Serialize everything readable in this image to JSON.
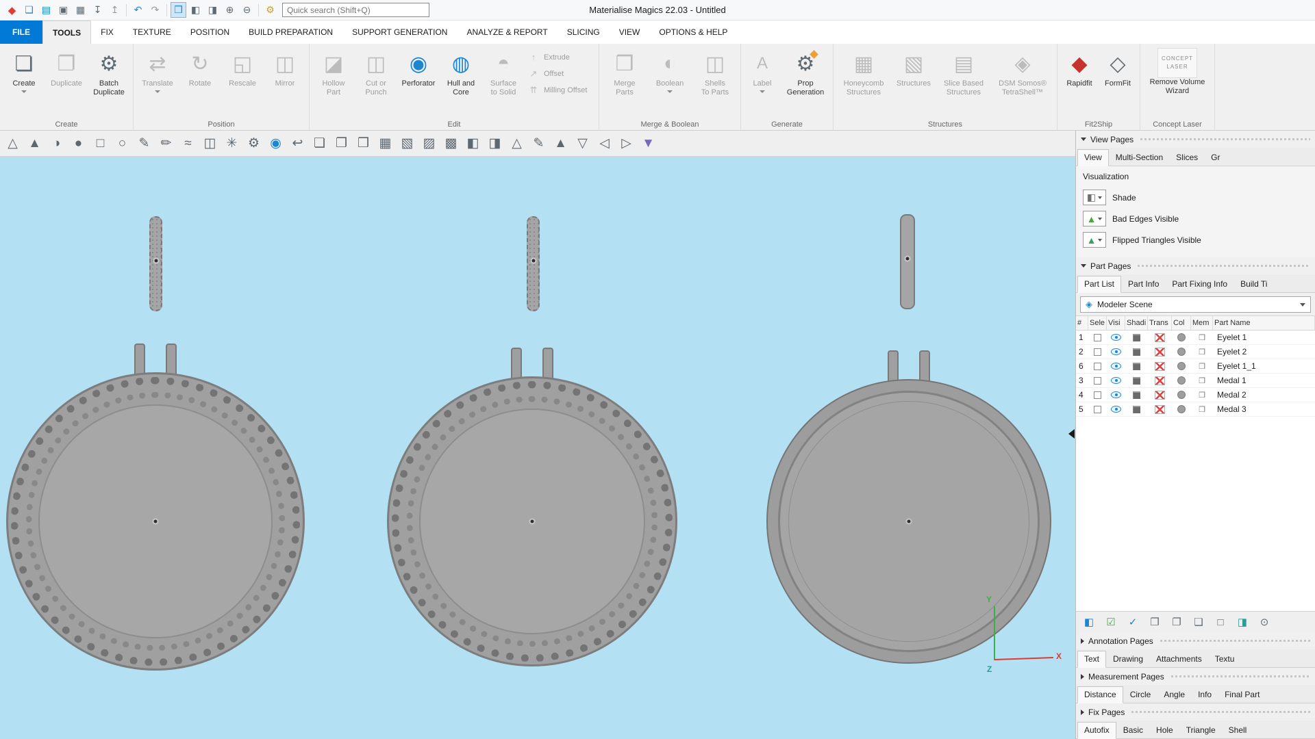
{
  "colors": {
    "accent_blue": "#0079d7",
    "viewport_background": "#b3e0f3",
    "part_gray": "#a0a0a0",
    "eye_blue": "#1c86d1",
    "axis_x_red": "#e0392f",
    "axis_y_green": "#3fae49",
    "axis_z_teal": "#2a9d94",
    "transparency_red": "#e04040"
  },
  "titlebar": {
    "title": "Materialise Magics 22.03 - Untitled",
    "search_placeholder": "Quick search (Shift+Q)",
    "icons": [
      {
        "name": "magics-logo-icon",
        "glyph": "◆"
      },
      {
        "name": "new-document-icon",
        "glyph": "❏"
      },
      {
        "name": "open-file-icon",
        "glyph": "▤"
      },
      {
        "name": "save-icon",
        "glyph": "▣"
      },
      {
        "name": "save-all-icon",
        "glyph": "▦"
      },
      {
        "name": "import-part-icon",
        "glyph": "↧"
      },
      {
        "name": "export-platform-icon",
        "glyph": "↥"
      },
      {
        "name": "undo-icon",
        "glyph": "↶"
      },
      {
        "name": "redo-icon",
        "glyph": "↷"
      },
      {
        "name": "zoom-selection-icon",
        "glyph": "❒"
      },
      {
        "name": "view-rotate-icon",
        "glyph": "◧"
      },
      {
        "name": "view-pan-icon",
        "glyph": "◨"
      },
      {
        "name": "zoom-in-icon",
        "glyph": "⊕"
      },
      {
        "name": "zoom-out-icon",
        "glyph": "⊖"
      },
      {
        "name": "license-key-icon",
        "glyph": "⚙"
      }
    ]
  },
  "menu": {
    "tabs": [
      "FILE",
      "TOOLS",
      "FIX",
      "TEXTURE",
      "POSITION",
      "BUILD PREPARATION",
      "SUPPORT GENERATION",
      "ANALYZE & REPORT",
      "SLICING",
      "VIEW",
      "OPTIONS & HELP"
    ]
  },
  "ribbon": {
    "groups": [
      {
        "name": "Create",
        "buttons": [
          {
            "label": "Create",
            "glyph": "❏"
          },
          {
            "label": "Duplicate",
            "glyph": "❐"
          },
          {
            "label": "Batch\nDuplicate",
            "glyph": "⚙"
          }
        ]
      },
      {
        "name": "Position",
        "buttons": [
          {
            "label": "Translate",
            "glyph": "⇄"
          },
          {
            "label": "Rotate",
            "glyph": "↻"
          },
          {
            "label": "Rescale",
            "glyph": "◱"
          },
          {
            "label": "Mirror",
            "glyph": "◫"
          }
        ]
      },
      {
        "name": "Edit",
        "buttons": [
          {
            "label": "Hollow\nPart",
            "glyph": "◪"
          },
          {
            "label": "Cut or\nPunch",
            "glyph": "◫"
          },
          {
            "label": "Perforator",
            "glyph": "◉"
          },
          {
            "label": "Hull and\nCore",
            "glyph": "◍"
          },
          {
            "label": "Surface\nto Solid",
            "glyph": "◓"
          }
        ],
        "stack": [
          {
            "label": "Extrude",
            "glyph": "↑"
          },
          {
            "label": "Offset",
            "glyph": "↗"
          },
          {
            "label": "Milling Offset",
            "glyph": "⇈"
          }
        ]
      },
      {
        "name": "Merge & Boolean",
        "buttons": [
          {
            "label": "Merge\nParts",
            "glyph": "❒"
          },
          {
            "label": "Boolean",
            "glyph": "◐"
          },
          {
            "label": "Shells\nTo Parts",
            "glyph": "◫"
          }
        ]
      },
      {
        "name": "Generate",
        "buttons": [
          {
            "label": "Label",
            "glyph": "A"
          },
          {
            "label": "Prop\nGeneration",
            "glyph": "⚙"
          }
        ]
      },
      {
        "name": "Structures",
        "buttons": [
          {
            "label": "Honeycomb\nStructures",
            "glyph": "▦"
          },
          {
            "label": "Structures",
            "glyph": "▧"
          },
          {
            "label": "Slice Based\nStructures",
            "glyph": "▤"
          },
          {
            "label": "DSM Somos®\nTetraShell™",
            "glyph": "◈"
          }
        ]
      },
      {
        "name": "Fit2Ship",
        "buttons": [
          {
            "label": "Rapidfit",
            "glyph": "◆"
          },
          {
            "label": "FormFit",
            "glyph": "◇"
          }
        ]
      },
      {
        "name": "Concept Laser",
        "logo": "CONCEPT\nLASER",
        "buttons": [
          {
            "label": "Remove Volume\nWizard"
          }
        ]
      }
    ]
  },
  "toolbar2": {
    "icons": [
      {
        "name": "mark-triangle-icon",
        "glyph": "△"
      },
      {
        "name": "mark-plane-icon",
        "glyph": "▲"
      },
      {
        "name": "mark-surface-icon",
        "glyph": "◑"
      },
      {
        "name": "mark-shell-icon",
        "glyph": "●"
      },
      {
        "name": "rectangle-selection-icon",
        "glyph": "□"
      },
      {
        "name": "ellipse-selection-icon",
        "glyph": "○"
      },
      {
        "name": "freeform-selection-icon",
        "glyph": "✎"
      },
      {
        "name": "brush-selection-icon",
        "glyph": "✏"
      },
      {
        "name": "wave-selection-icon",
        "glyph": "≈"
      },
      {
        "name": "cross-section-icon",
        "glyph": "◫"
      },
      {
        "name": "star-mark-icon",
        "glyph": "✳"
      },
      {
        "name": "gear-mark-icon",
        "glyph": "⚙"
      },
      {
        "name": "ring-mark-icon",
        "glyph": "◉"
      },
      {
        "name": "hook-mark-icon",
        "glyph": "↩"
      },
      {
        "name": "cube-view-top-icon",
        "glyph": "❏"
      },
      {
        "name": "cube-view-front-icon",
        "glyph": "❐"
      },
      {
        "name": "cube-view-side-icon",
        "glyph": "❒"
      },
      {
        "name": "cube-shaded-icon",
        "glyph": "▦"
      },
      {
        "name": "cube-hatched-icon",
        "glyph": "▧"
      },
      {
        "name": "cube-crossed-icon",
        "glyph": "▨"
      },
      {
        "name": "cube-grid-icon",
        "glyph": "▩"
      },
      {
        "name": "cube-half-left-icon",
        "glyph": "◧"
      },
      {
        "name": "cube-half-right-icon",
        "glyph": "◨"
      },
      {
        "name": "triangle-edit-icon",
        "glyph": "△"
      },
      {
        "name": "triangle-pencil-icon",
        "glyph": "✎"
      },
      {
        "name": "triangle-fill-icon",
        "glyph": "▲"
      },
      {
        "name": "triangle-down-icon",
        "glyph": "▽"
      },
      {
        "name": "triangle-left-icon",
        "glyph": "◁"
      },
      {
        "name": "triangle-right-icon",
        "glyph": "▷"
      },
      {
        "name": "triangle-textured-icon",
        "glyph": "▼"
      }
    ]
  },
  "right_panel": {
    "view_pages": {
      "title": "View Pages",
      "tabs": [
        "View",
        "Multi-Section",
        "Slices",
        "Gr"
      ],
      "visualization": {
        "label": "Visualization",
        "rows": [
          {
            "icon": "shade-cube-icon",
            "glyph": "◧",
            "label": "Shade"
          },
          {
            "icon": "bad-edges-icon",
            "glyph": "▲",
            "label": "Bad Edges Visible"
          },
          {
            "icon": "flipped-triangles-icon",
            "glyph": "▲",
            "label": "Flipped Triangles Visible"
          }
        ]
      }
    },
    "part_pages": {
      "title": "Part Pages",
      "tabs": [
        "Part List",
        "Part Info",
        "Part Fixing Info",
        "Build Ti"
      ],
      "scene": {
        "icon": "modeler-scene-icon",
        "glyph": "◈",
        "label": "Modeler Scene"
      },
      "table": {
        "columns": [
          "#",
          "Sele",
          "Visi",
          "Shadi",
          "Trans",
          "Col",
          "Mem",
          "Part Name"
        ],
        "rows": [
          {
            "num": "1",
            "name": "Eyelet 1"
          },
          {
            "num": "2",
            "name": "Eyelet 2"
          },
          {
            "num": "6",
            "name": "Eyelet 1_1"
          },
          {
            "num": "3",
            "name": "Medal 1"
          },
          {
            "num": "4",
            "name": "Medal 2"
          },
          {
            "num": "5",
            "name": "Medal 3"
          }
        ]
      },
      "toolbar_icons": [
        {
          "name": "scene-functions-icon",
          "glyph": "◧"
        },
        {
          "name": "visibility-check-icon",
          "glyph": "☑"
        },
        {
          "name": "select-check-icon",
          "glyph": "✓"
        },
        {
          "name": "multi-cube-icon",
          "glyph": "❒"
        },
        {
          "name": "cube-pair-icon",
          "glyph": "❐"
        },
        {
          "name": "cube-pair-outline-icon",
          "glyph": "❏"
        },
        {
          "name": "cube-outline-icon",
          "glyph": "□"
        },
        {
          "name": "colored-cube-icon",
          "glyph": "◨"
        },
        {
          "name": "zoom-part-icon",
          "glyph": "⊙"
        }
      ]
    },
    "annotation_pages": {
      "title": "Annotation Pages",
      "tabs": [
        "Text",
        "Drawing",
        "Attachments",
        "Textu"
      ]
    },
    "measurement_pages": {
      "title": "Measurement Pages",
      "tabs": [
        "Distance",
        "Circle",
        "Angle",
        "Info",
        "Final Part"
      ]
    },
    "fix_pages": {
      "title": "Fix Pages",
      "tabs": [
        "Autofix",
        "Basic",
        "Hole",
        "Triangle",
        "Shell"
      ]
    }
  },
  "viewport": {
    "axis": {
      "x": "X",
      "y": "Y",
      "z": "Z"
    }
  }
}
